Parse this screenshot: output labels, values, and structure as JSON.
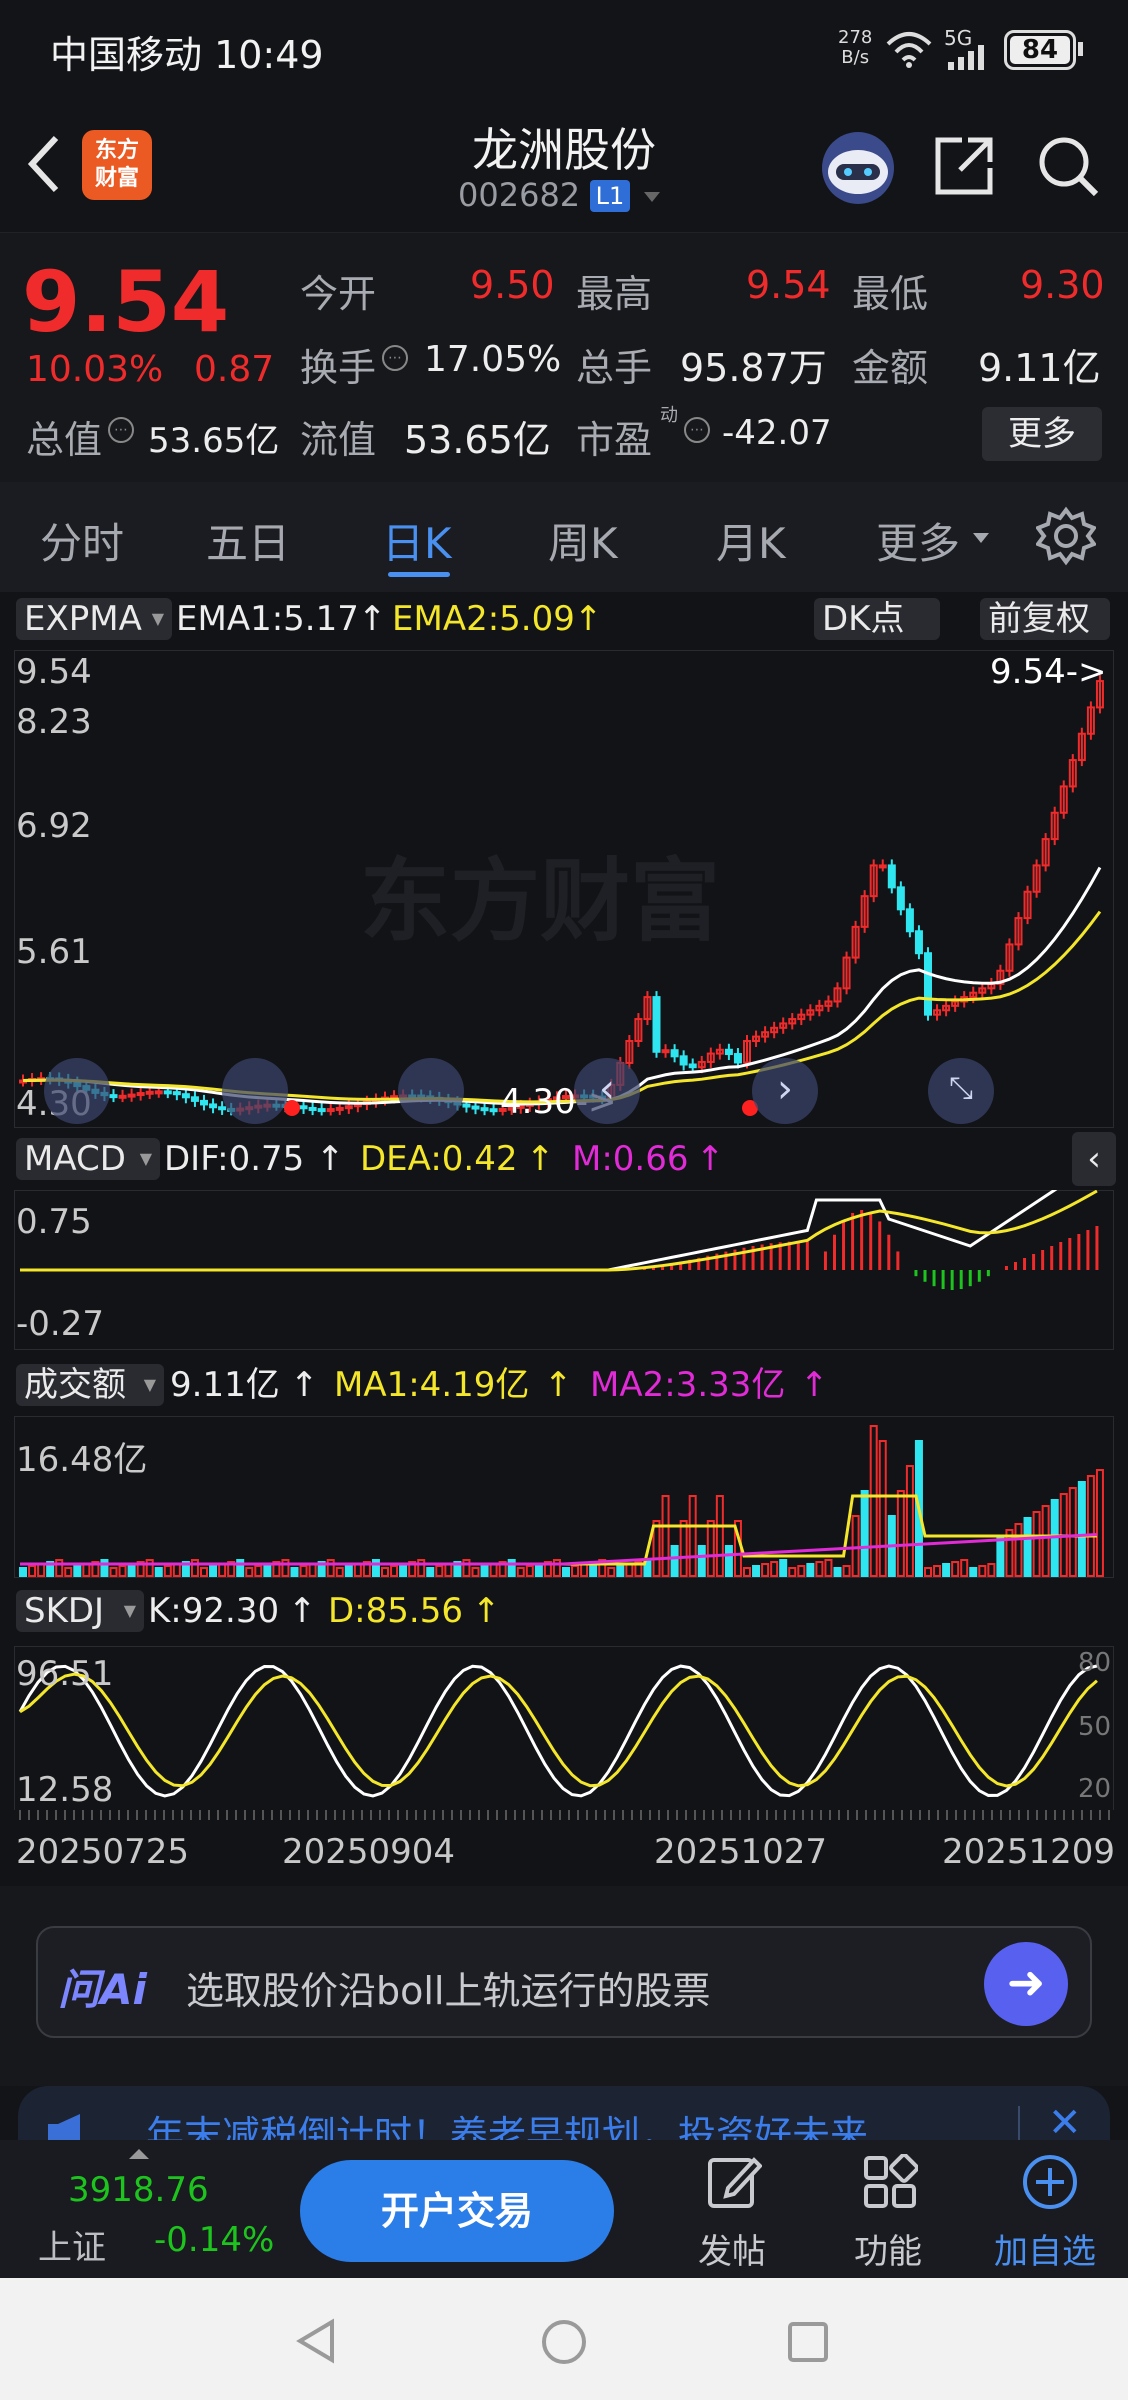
{
  "status": {
    "carrier_time": "中国移动 10:49",
    "net_speed_top": "278",
    "net_speed_bottom": "B/s",
    "net_type": "5G",
    "battery": "84"
  },
  "header": {
    "brand_top": "东方",
    "brand_bottom": "财富",
    "stock_name": "龙洲股份",
    "stock_code": "002682",
    "level_badge": "L1"
  },
  "quote": {
    "price": "9.54",
    "change_pct": "10.03%",
    "change_abs": "0.87",
    "open_label": "今开",
    "open": "9.50",
    "high_label": "最高",
    "high": "9.54",
    "low_label": "最低",
    "low": "9.30",
    "turnover_label": "换手",
    "turnover": "17.05%",
    "volume_label": "总手",
    "volume": "95.87万",
    "amount_label": "金额",
    "amount": "9.11亿",
    "mktcap_label": "总值",
    "mktcap": "53.65亿",
    "float_label": "流值",
    "float": "53.65亿",
    "pe_label": "市盈",
    "pe_sup": "动",
    "pe": "-42.07",
    "more_button": "更多"
  },
  "tabs": [
    {
      "label": "分时"
    },
    {
      "label": "五日"
    },
    {
      "label": "日K"
    },
    {
      "label": "周K"
    },
    {
      "label": "月K"
    },
    {
      "label": "更多"
    }
  ],
  "main_panel": {
    "indicator": "EXPMA",
    "ema1": "EMA1:5.17",
    "ema2": "EMA2:5.09",
    "dk_button": "DK点",
    "adjust_button": "前复权",
    "y_labels": [
      "9.54",
      "8.23",
      "6.92",
      "5.61",
      "4.30"
    ],
    "last_price_marker": "9.54->",
    "low_marker": "4.30->",
    "watermark": "东方财富"
  },
  "macd_panel": {
    "indicator": "MACD",
    "dif": "DIF:0.75",
    "dea": "DEA:0.42",
    "m": "M:0.66",
    "y_top": "0.75",
    "y_bottom": "-0.27"
  },
  "vol_panel": {
    "indicator": "成交额",
    "value": "9.11亿",
    "ma1": "MA1:4.19亿",
    "ma2": "MA2:3.33亿",
    "y_top": "16.48亿"
  },
  "skdj_panel": {
    "indicator": "SKDJ",
    "k": "K:92.30",
    "d": "D:85.56",
    "y_top": "96.51",
    "y_bottom": "12.58",
    "ref_80": "80",
    "ref_50": "50",
    "ref_20": "20"
  },
  "dates": [
    "20250725",
    "20250904",
    "20251027",
    "20251209"
  ],
  "ask": {
    "logo": "问Ai",
    "placeholder": "选取股价沿boll上轨运行的股票"
  },
  "banner": {
    "text": "年末减税倒计时！养老早规划，投资好未来"
  },
  "bottom": {
    "index_value": "3918.76",
    "index_name": "上证",
    "index_change": "-0.14%",
    "trade_button": "开户交易",
    "post": "发帖",
    "features": "功能",
    "add_watch": "加自选"
  },
  "colors": {
    "up": "#f02b2b",
    "down": "#1ec41e",
    "cyan": "#2fe6f0",
    "yellow": "#f4e62a",
    "magenta": "#e02bd6",
    "accent": "#4a90f0"
  }
}
